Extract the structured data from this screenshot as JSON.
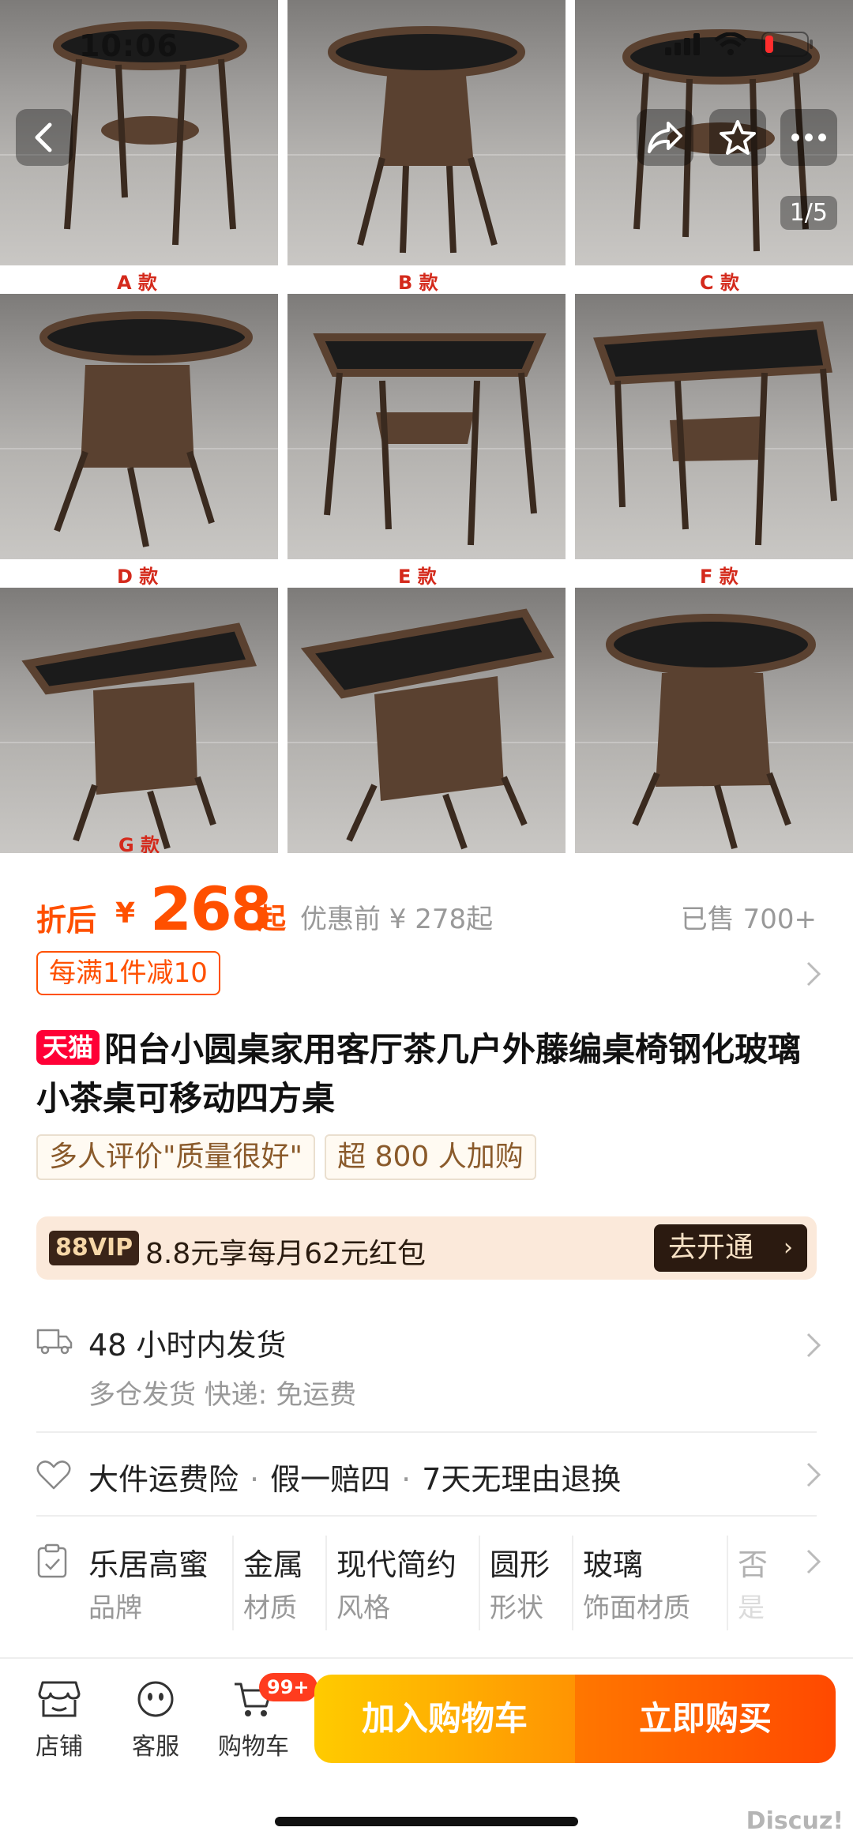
{
  "status": {
    "time": "10:06"
  },
  "gallery": {
    "pager": "1/5",
    "variants": [
      "A 款",
      "B 款",
      "C 款",
      "D 款",
      "E 款",
      "F 款",
      "G 款"
    ]
  },
  "price": {
    "prefix": "折后",
    "currency": "¥",
    "amount": "268",
    "suffix": "起",
    "before": "优惠前 ¥ 278起",
    "sold": "已售 700+"
  },
  "coupon": {
    "label": "每满1件减10"
  },
  "title": {
    "badge": "天猫",
    "text": "阳台小圆桌家用客厅茶几户外藤编桌椅钢化玻璃小茶桌可移动四方桌"
  },
  "tags": [
    "多人评价\"质量很好\"",
    "超 800 人加购"
  ],
  "vip": {
    "badge": "88VIP",
    "text": "8.8元享每月62元红包",
    "button": "去开通"
  },
  "shipping": {
    "main": "48 小时内发货",
    "sub": "多仓发货  快递: 免运费"
  },
  "guarantee": {
    "items": [
      "大件运费险",
      "假一赔四",
      "7天无理由退换"
    ]
  },
  "specs": [
    {
      "value": "乐居高蜜",
      "key": "品牌"
    },
    {
      "value": "金属",
      "key": "材质"
    },
    {
      "value": "现代简约",
      "key": "风格"
    },
    {
      "value": "圆形",
      "key": "形状"
    },
    {
      "value": "玻璃",
      "key": "饰面材质"
    },
    {
      "value": "否",
      "key": "是"
    }
  ],
  "bottom_bar": {
    "store": "店铺",
    "service": "客服",
    "cart": "购物车",
    "cart_badge": "99+",
    "add_to_cart": "加入购物车",
    "buy_now": "立即购买"
  },
  "watermark": "Discuz!",
  "colors": {
    "accent": "#ff5000",
    "tmall": "#ff0036",
    "vip_bg": "#fbe9da"
  }
}
